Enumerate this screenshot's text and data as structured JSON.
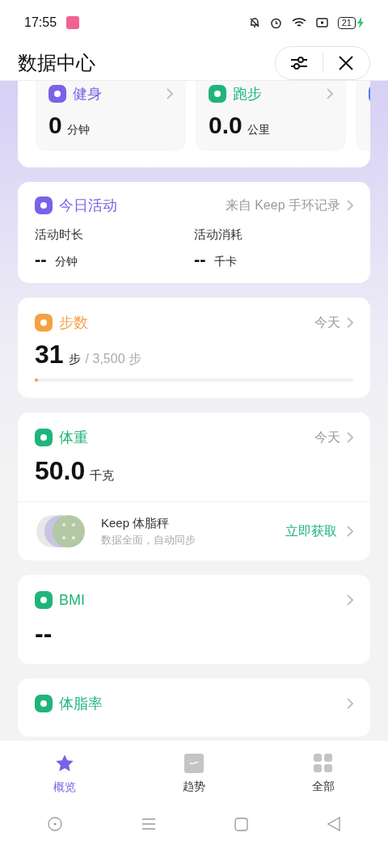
{
  "status_bar": {
    "time": "17:55",
    "battery": "21"
  },
  "header": {
    "title": "数据中心"
  },
  "summary_tiles": [
    {
      "title": "健身",
      "value": "0",
      "unit": "分钟",
      "color": "#7b61e8"
    },
    {
      "title": "跑步",
      "value": "0.0",
      "unit": "公里",
      "color": "#1fb57a"
    },
    {
      "color": "#4a7cf0"
    }
  ],
  "cards": [
    {
      "kind": "activity",
      "title": "今日活动",
      "color": "#7b61e8",
      "meta": "来自 Keep 手环记录",
      "stats": [
        {
          "label": "活动时长",
          "value": "--",
          "unit": "分钟"
        },
        {
          "label": "活动消耗",
          "value": "--",
          "unit": "千卡"
        }
      ]
    },
    {
      "kind": "progress",
      "title": "步数",
      "color": "#f5a142",
      "meta": "今天",
      "value": "31",
      "unit": "步",
      "goal": "/ 3,500 步",
      "level": 0.01
    },
    {
      "kind": "value",
      "title": "体重",
      "color": "#1fb57a",
      "meta": "今天",
      "value": "50.0",
      "unit": "千克",
      "promo": {
        "title": "Keep 体脂秤",
        "subtitle": "数据全面，自动同步",
        "action": "立即获取"
      }
    },
    {
      "kind": "value",
      "title": "BMI",
      "color": "#1fb57a",
      "value": "--"
    },
    {
      "kind": "value",
      "title": "体脂率",
      "color": "#1fb57a"
    }
  ],
  "tabs": [
    {
      "label": "概览",
      "selected": true
    },
    {
      "label": "趋势",
      "selected": false
    },
    {
      "label": "全部",
      "selected": false
    }
  ]
}
